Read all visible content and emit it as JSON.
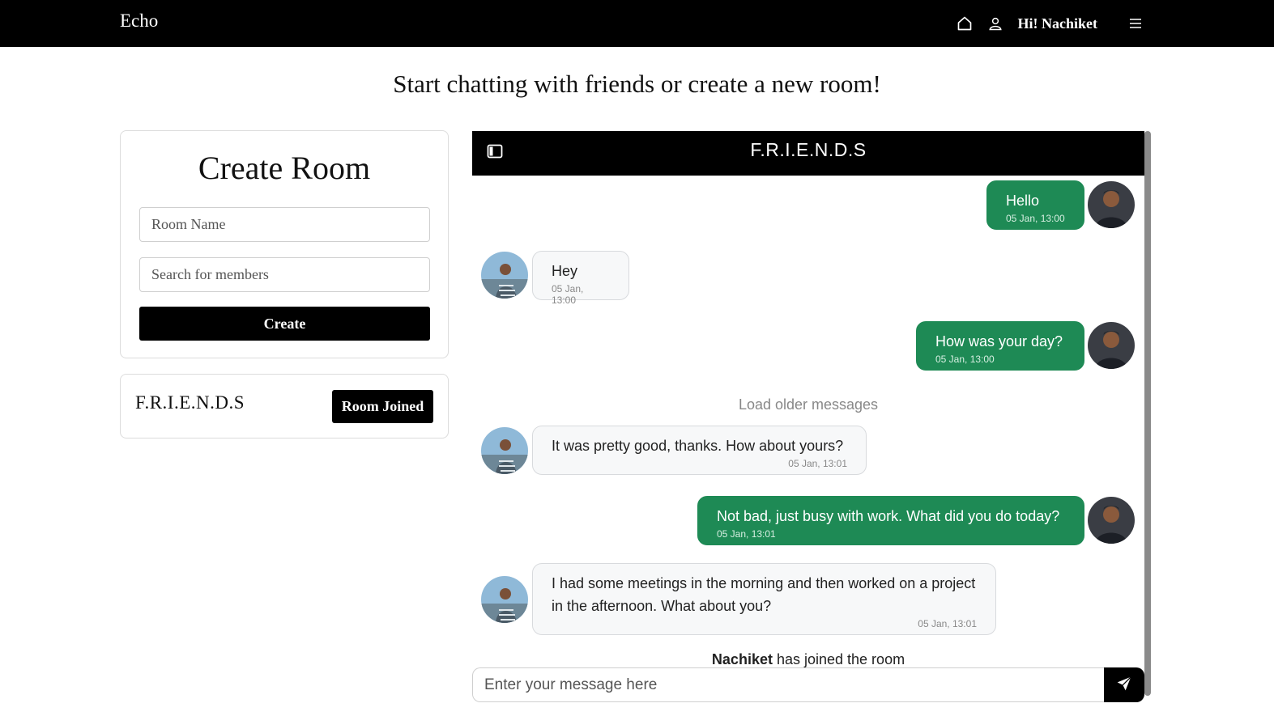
{
  "app": {
    "brand": "Echo"
  },
  "nav": {
    "home_icon": "home-icon",
    "user_icon": "user-icon",
    "greeting": "Hi! Nachiket",
    "menu_icon": "hamburger-icon"
  },
  "headline": "Start chatting with friends or create a new room!",
  "create_room": {
    "title": "Create Room",
    "room_name_placeholder": "Room Name",
    "room_name_value": "",
    "members_placeholder": "Search for members",
    "members_value": "",
    "button_label": "Create"
  },
  "rooms": [
    {
      "name": "F.R.I.E.N.D.S",
      "button_label": "Room Joined"
    }
  ],
  "chat": {
    "title": "F.R.I.E.N.D.S",
    "load_older": "Load older messages",
    "messages": [
      {
        "direction": "out",
        "text": "Hello",
        "time": "05 Jan, 13:00"
      },
      {
        "direction": "in",
        "text": "Hey",
        "time": "05 Jan, 13:00"
      },
      {
        "direction": "out",
        "text": "How was your day?",
        "time": "05 Jan, 13:00"
      },
      {
        "direction": "in",
        "text": "It was pretty good, thanks. How about yours?",
        "time": "05 Jan, 13:01"
      },
      {
        "direction": "out",
        "text": "Not bad, just busy with work. What did you do today?",
        "time": "05 Jan, 13:01"
      },
      {
        "direction": "in",
        "text": "I had some meetings in the morning and then worked on a project in the afternoon. What about you?",
        "time": "05 Jan, 13:01"
      }
    ],
    "system_user": "Nachiket",
    "system_text": " has joined the room",
    "input_placeholder": "Enter your message here",
    "input_value": "",
    "colors": {
      "outgoing": "#1e8a55",
      "incoming": "#f7f8f9",
      "header": "#000000"
    }
  }
}
